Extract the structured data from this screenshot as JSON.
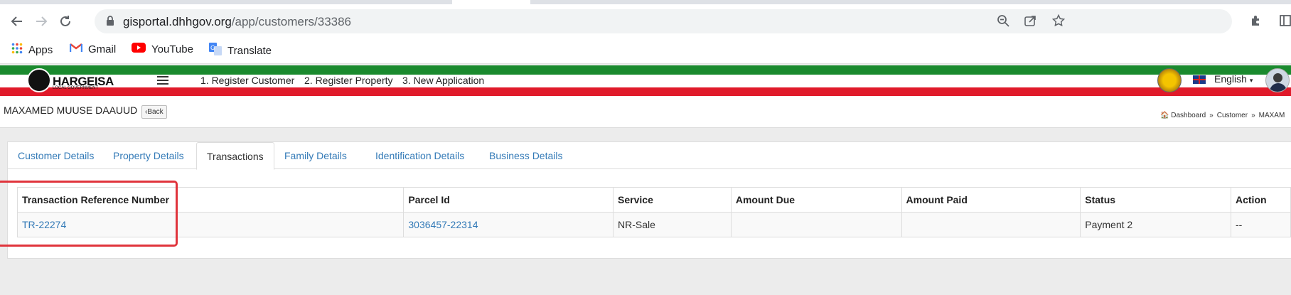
{
  "browser": {
    "url_host": "gisportal.dhhgov.org",
    "url_path": "/app/customers/33386",
    "bookmarks": [
      {
        "label": "Apps",
        "icon": "apps-grid-icon"
      },
      {
        "label": "Gmail",
        "icon": "gmail-icon"
      },
      {
        "label": "YouTube",
        "icon": "youtube-icon"
      },
      {
        "label": "Translate",
        "icon": "translate-icon"
      }
    ]
  },
  "site": {
    "logo_text": "HARGEISA",
    "logo_sub": "LOCAL GOVERNMENT",
    "nav": [
      "1. Register Customer",
      "2. Register Property",
      "3. New Application"
    ],
    "language": "English",
    "colors": {
      "green": "#1a8a2e",
      "red": "#e01a2a",
      "link": "#337ab7"
    }
  },
  "page": {
    "title": "MAXAMED MUUSE DAAUUD",
    "back_label": "Back",
    "breadcrumbs": [
      "Dashboard",
      "Customer",
      "MAXAM"
    ]
  },
  "tabs": [
    {
      "label": "Customer Details",
      "active": false
    },
    {
      "label": "Property Details",
      "active": false
    },
    {
      "label": "Transactions",
      "active": true
    },
    {
      "label": "Family Details",
      "active": false
    },
    {
      "label": "Identification Details",
      "active": false
    },
    {
      "label": "Business Details",
      "active": false
    }
  ],
  "table": {
    "headers": [
      "Transaction Reference Number",
      "Parcel Id",
      "Service",
      "Amount Due",
      "Amount Paid",
      "Status",
      "Action"
    ],
    "rows": [
      {
        "ref": "TR-22274",
        "parcel": "3036457-22314",
        "service": "NR-Sale",
        "amount_due": "",
        "amount_paid": "",
        "status": "Payment 2",
        "action": "--"
      }
    ]
  }
}
